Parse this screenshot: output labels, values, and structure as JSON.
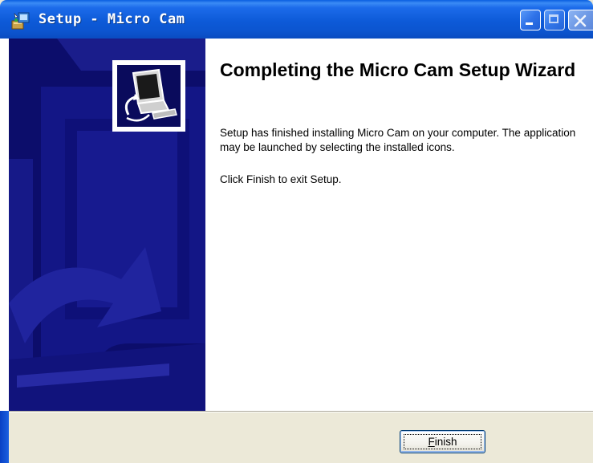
{
  "window": {
    "title": "Setup - Micro Cam",
    "icon": "setup-installer-icon",
    "controls": {
      "minimize": "minimize-icon",
      "maximize": "maximize-icon",
      "close": "close-icon"
    }
  },
  "page": {
    "heading": "Completing the Micro Cam Setup Wizard",
    "message": "Setup has finished installing Micro Cam on your computer. The application may be launched by selecting the installed icons.",
    "instruction": "Click Finish to exit Setup."
  },
  "sidebar": {
    "icon": "computer-install-icon"
  },
  "buttons": {
    "finish_mnemonic": "F",
    "finish_rest": "inish"
  },
  "colors": {
    "titlebar": "#0c55d0",
    "sidebar": "#0c0d6b",
    "dialog_bg": "#ece9d8"
  }
}
